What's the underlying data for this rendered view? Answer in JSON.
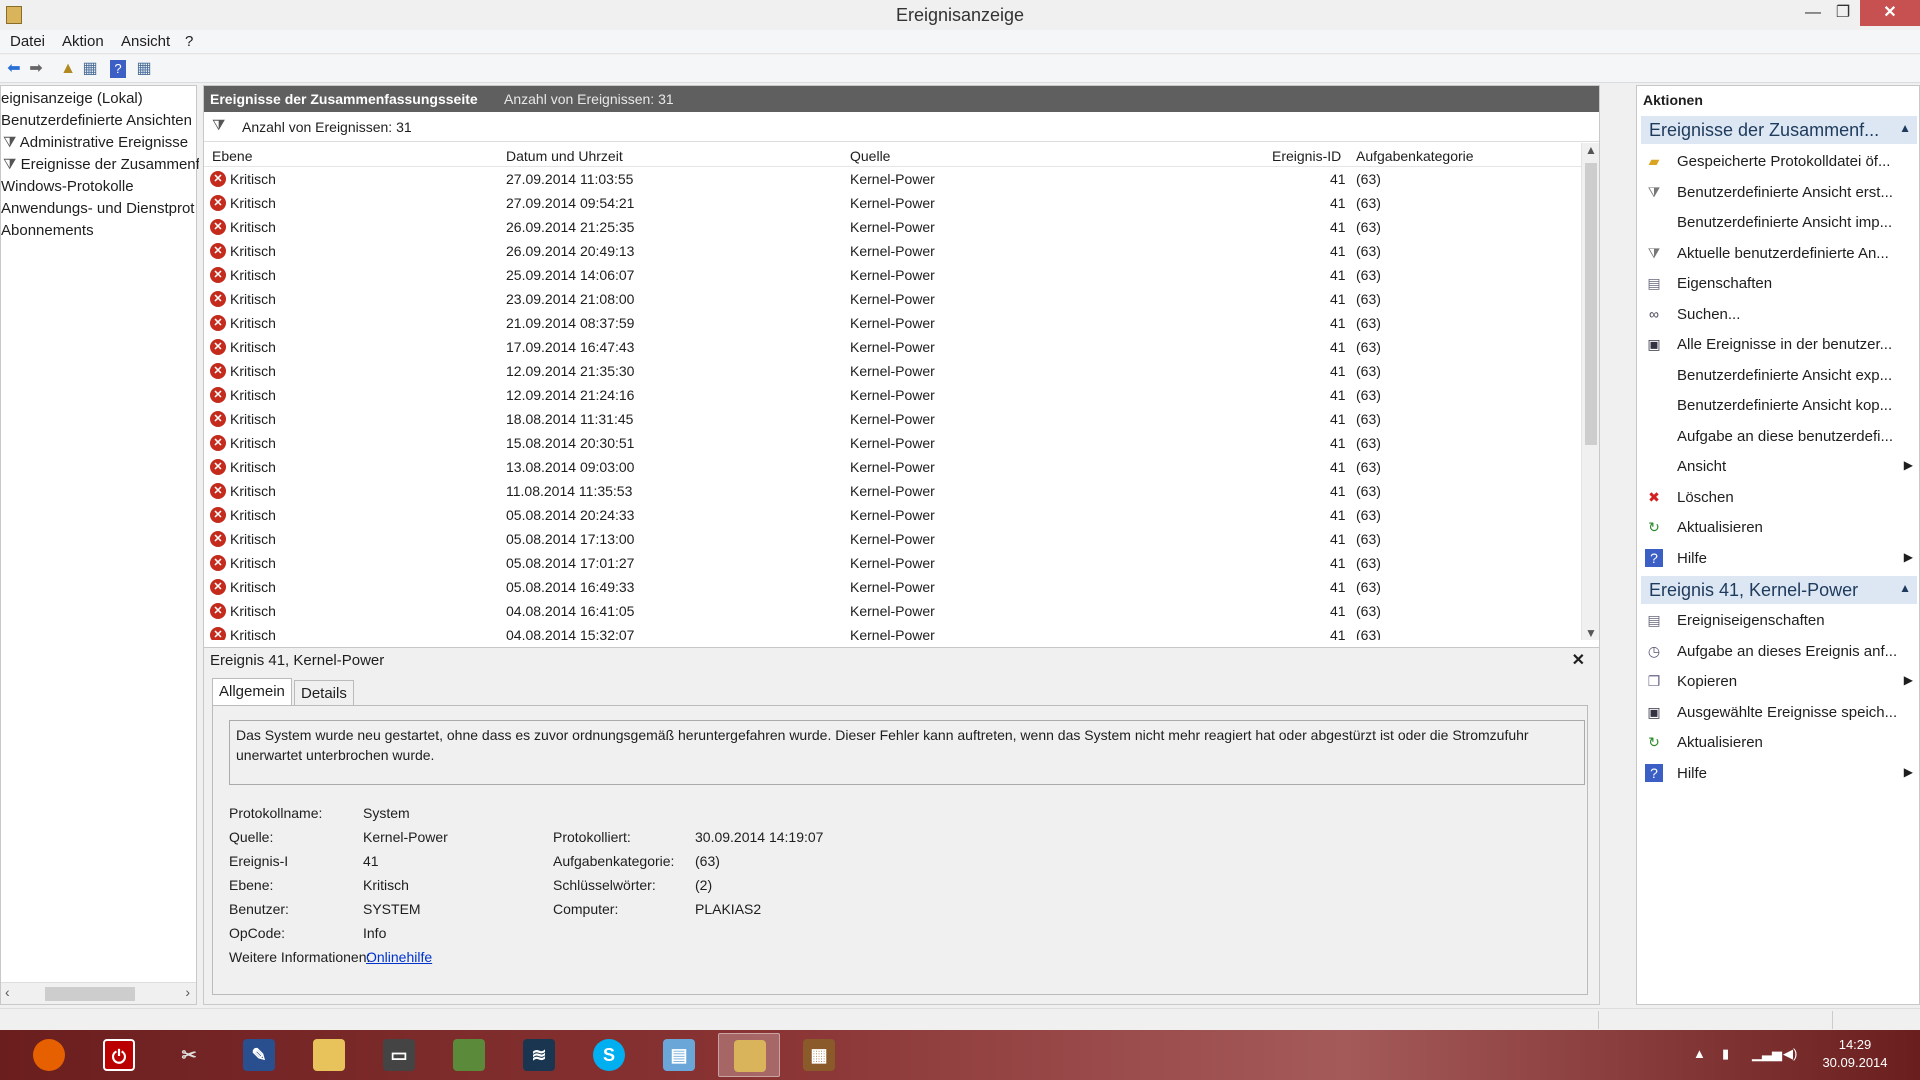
{
  "window": {
    "title": "Ereignisanzeige",
    "min": "—",
    "max": "❐",
    "close": "✕"
  },
  "menu": [
    "Datei",
    "Aktion",
    "Ansicht",
    "?"
  ],
  "tree": [
    "eignisanzeige (Lokal)",
    "Benutzerdefinierte Ansichten",
    "Administrative Ereignisse",
    "Ereignisse der Zusammenf...",
    "Windows-Protokolle",
    "Anwendungs- und Dienstprot",
    "Abonnements"
  ],
  "center": {
    "header_title": "Ereignisse der Zusammenfassungsseite",
    "header_count": "Anzahl von Ereignissen: 31",
    "filter_text": "Anzahl von Ereignissen: 31",
    "columns": [
      "Ebene",
      "Datum und Uhrzeit",
      "Quelle",
      "Ereignis-ID",
      "Aufgabenkategorie"
    ],
    "rows": [
      {
        "level": "Kritisch",
        "date": "27.09.2014 11:03:55",
        "source": "Kernel-Power",
        "id": "41",
        "cat": "(63)"
      },
      {
        "level": "Kritisch",
        "date": "27.09.2014 09:54:21",
        "source": "Kernel-Power",
        "id": "41",
        "cat": "(63)"
      },
      {
        "level": "Kritisch",
        "date": "26.09.2014 21:25:35",
        "source": "Kernel-Power",
        "id": "41",
        "cat": "(63)"
      },
      {
        "level": "Kritisch",
        "date": "26.09.2014 20:49:13",
        "source": "Kernel-Power",
        "id": "41",
        "cat": "(63)"
      },
      {
        "level": "Kritisch",
        "date": "25.09.2014 14:06:07",
        "source": "Kernel-Power",
        "id": "41",
        "cat": "(63)"
      },
      {
        "level": "Kritisch",
        "date": "23.09.2014 21:08:00",
        "source": "Kernel-Power",
        "id": "41",
        "cat": "(63)"
      },
      {
        "level": "Kritisch",
        "date": "21.09.2014 08:37:59",
        "source": "Kernel-Power",
        "id": "41",
        "cat": "(63)"
      },
      {
        "level": "Kritisch",
        "date": "17.09.2014 16:47:43",
        "source": "Kernel-Power",
        "id": "41",
        "cat": "(63)"
      },
      {
        "level": "Kritisch",
        "date": "12.09.2014 21:35:30",
        "source": "Kernel-Power",
        "id": "41",
        "cat": "(63)"
      },
      {
        "level": "Kritisch",
        "date": "12.09.2014 21:24:16",
        "source": "Kernel-Power",
        "id": "41",
        "cat": "(63)"
      },
      {
        "level": "Kritisch",
        "date": "18.08.2014 11:31:45",
        "source": "Kernel-Power",
        "id": "41",
        "cat": "(63)"
      },
      {
        "level": "Kritisch",
        "date": "15.08.2014 20:30:51",
        "source": "Kernel-Power",
        "id": "41",
        "cat": "(63)"
      },
      {
        "level": "Kritisch",
        "date": "13.08.2014 09:03:00",
        "source": "Kernel-Power",
        "id": "41",
        "cat": "(63)"
      },
      {
        "level": "Kritisch",
        "date": "11.08.2014 11:35:53",
        "source": "Kernel-Power",
        "id": "41",
        "cat": "(63)"
      },
      {
        "level": "Kritisch",
        "date": "05.08.2014 20:24:33",
        "source": "Kernel-Power",
        "id": "41",
        "cat": "(63)"
      },
      {
        "level": "Kritisch",
        "date": "05.08.2014 17:13:00",
        "source": "Kernel-Power",
        "id": "41",
        "cat": "(63)"
      },
      {
        "level": "Kritisch",
        "date": "05.08.2014 17:01:27",
        "source": "Kernel-Power",
        "id": "41",
        "cat": "(63)"
      },
      {
        "level": "Kritisch",
        "date": "05.08.2014 16:49:33",
        "source": "Kernel-Power",
        "id": "41",
        "cat": "(63)"
      },
      {
        "level": "Kritisch",
        "date": "04.08.2014 16:41:05",
        "source": "Kernel-Power",
        "id": "41",
        "cat": "(63)"
      },
      {
        "level": "Kritisch",
        "date": "04.08.2014 15:32:07",
        "source": "Kernel-Power",
        "id": "41",
        "cat": "(63)"
      }
    ]
  },
  "detail": {
    "title": "Ereignis 41, Kernel-Power",
    "close": "✕",
    "tabs": [
      "Allgemein",
      "Details"
    ],
    "description": "Das System wurde neu gestartet, ohne dass es zuvor ordnungsgemäß heruntergefahren wurde. Dieser Fehler kann auftreten, wenn das System nicht mehr reagiert hat oder abgestürzt ist oder die Stromzufuhr unerwartet unterbrochen wurde.",
    "fields_left": [
      {
        "label": "Protokollname:",
        "value": "System"
      },
      {
        "label": "Quelle:",
        "value": "Kernel-Power"
      },
      {
        "label": "Ereignis-I",
        "value": "41"
      },
      {
        "label": "Ebene:",
        "value": "Kritisch"
      },
      {
        "label": "Benutzer:",
        "value": "SYSTEM"
      },
      {
        "label": "OpCode:",
        "value": "Info"
      },
      {
        "label": "Weitere Informationen:",
        "value": "Onlinehilfe"
      }
    ],
    "fields_right": [
      {
        "label": "Protokolliert:",
        "value": "30.09.2014 14:19:07"
      },
      {
        "label": "Aufgabenkategorie:",
        "value": "(63)"
      },
      {
        "label": "Schlüsselwörter:",
        "value": "(2)"
      },
      {
        "label": "Computer:",
        "value": "PLAKIAS2"
      }
    ]
  },
  "actions": {
    "heading": "Aktionen",
    "section1": "Ereignisse der Zusammenf...",
    "items1": [
      {
        "label": "Gespeicherte Protokolldatei öf...",
        "icon": "folder-icon"
      },
      {
        "label": "Benutzerdefinierte Ansicht erst...",
        "icon": "filter-icon"
      },
      {
        "label": "Benutzerdefinierte Ansicht imp...",
        "icon": ""
      },
      {
        "label": "Aktuelle benutzerdefinierte An...",
        "icon": "filter-icon"
      },
      {
        "label": "Eigenschaften",
        "icon": "properties-icon"
      },
      {
        "label": "Suchen...",
        "icon": "binoculars-icon"
      },
      {
        "label": "Alle Ereignisse in der benutzer...",
        "icon": "save-icon"
      },
      {
        "label": "Benutzerdefinierte Ansicht exp...",
        "icon": ""
      },
      {
        "label": "Benutzerdefinierte Ansicht kop...",
        "icon": ""
      },
      {
        "label": "Aufgabe an diese benutzerdefi...",
        "icon": ""
      },
      {
        "label": "Ansicht",
        "icon": "",
        "sub": true
      },
      {
        "label": "Löschen",
        "icon": "delete-icon"
      },
      {
        "label": "Aktualisieren",
        "icon": "refresh-icon"
      },
      {
        "label": "Hilfe",
        "icon": "help-icon",
        "sub": true
      }
    ],
    "section2": "Ereignis 41, Kernel-Power",
    "items2": [
      {
        "label": "Ereigniseigenschaften",
        "icon": "properties-icon"
      },
      {
        "label": "Aufgabe an dieses Ereignis anf...",
        "icon": "task-icon"
      },
      {
        "label": "Kopieren",
        "icon": "copy-icon",
        "sub": true
      },
      {
        "label": "Ausgewählte Ereignisse speich...",
        "icon": "save-icon"
      },
      {
        "label": "Aktualisieren",
        "icon": "refresh-icon"
      },
      {
        "label": "Hilfe",
        "icon": "help-icon",
        "sub": true
      }
    ]
  },
  "taskbar": {
    "time": "14:29",
    "date": "30.09.2014"
  }
}
